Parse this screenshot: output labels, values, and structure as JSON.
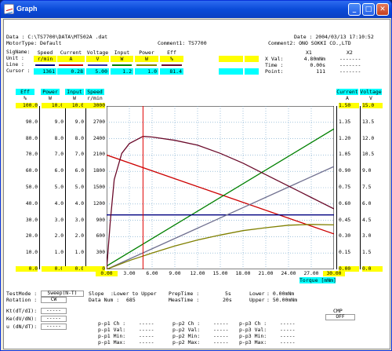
{
  "window": {
    "title": "Graph"
  },
  "header": {
    "data_label": "Data : C:\\TS7700\\DATA\\MT502A .dat",
    "date_label": "Date :  2004/03/13  17:10:52",
    "motortype_label": "MotorType: Default",
    "comment1_label": "Comment1: TS7700",
    "comment2_label": "Comment2: ONO SOKKI CO.,LTD"
  },
  "legend_table": {
    "row_labels": [
      "SigName:",
      "Unit   :",
      "Line   :",
      "Cursor :"
    ],
    "columns": [
      {
        "name": "Speed",
        "unit": "r/min",
        "cursor": "1361",
        "line_color": "#000080"
      },
      {
        "name": "Current",
        "unit": "A",
        "cursor": "0.28",
        "line_color": "#cc0000"
      },
      {
        "name": "Voltage",
        "unit": "V",
        "cursor": "5.00",
        "line_color": "#3030a0"
      },
      {
        "name": "Input",
        "unit": "W",
        "cursor": "1.2",
        "line_color": "#008000"
      },
      {
        "name": "Power",
        "unit": "W",
        "cursor": "1.0",
        "line_color": "#808000"
      },
      {
        "name": "Eff",
        "unit": "%",
        "cursor": "81.4",
        "line_color": "#6a0a2a"
      }
    ]
  },
  "cursor_panel": {
    "x1_header": "X1",
    "x2_header": "X2",
    "xval_label": "X Val:",
    "xval_value": "4.80mNm",
    "xval_x2": "-------",
    "time_label": "Time :",
    "time_value": "0.00s",
    "time_x2": "-------",
    "point_label": "Point:",
    "point_value": "111",
    "point_x2": "-------"
  },
  "chart_data": {
    "type": "line",
    "xlabel": "Torque [mNm]",
    "x_ticks": [
      "0.00",
      "3.00",
      "6.00",
      "9.00",
      "12.00",
      "15.00",
      "18.00",
      "21.00",
      "24.00",
      "27.00",
      "30.00"
    ],
    "xlim": [
      0,
      30
    ],
    "cursor_x": 4.8,
    "left_axes": [
      {
        "name": "Eff",
        "unit": "%",
        "ticks": [
          "100.0",
          "90.0",
          "80.0",
          "70.0",
          "60.0",
          "50.0",
          "40.0",
          "30.0",
          "20.0",
          "10.0",
          "0.0"
        ]
      },
      {
        "name": "Power",
        "unit": "W",
        "ticks": [
          "10.0",
          "9.0",
          "8.0",
          "7.0",
          "6.0",
          "5.0",
          "4.0",
          "3.0",
          "2.0",
          "1.0",
          "0.0"
        ]
      },
      {
        "name": "Input",
        "unit": "W",
        "ticks": [
          "10.0",
          "9.0",
          "8.0",
          "7.0",
          "6.0",
          "5.0",
          "4.0",
          "3.0",
          "2.0",
          "1.0",
          "0.0"
        ]
      },
      {
        "name": "Speed",
        "unit": "r/min",
        "ticks": [
          "3000",
          "2700",
          "2400",
          "2100",
          "1800",
          "1500",
          "1200",
          "900",
          "600",
          "300",
          "0"
        ]
      }
    ],
    "right_axes": [
      {
        "name": "Current",
        "unit": "A",
        "ticks": [
          "1.50",
          "1.35",
          "1.20",
          "1.05",
          "0.90",
          "0.75",
          "0.60",
          "0.45",
          "0.30",
          "0.15",
          "0.00"
        ]
      },
      {
        "name": "Voltage",
        "unit": "V",
        "ticks": [
          "15.0",
          "13.5",
          "12.0",
          "10.5",
          "9.0",
          "7.5",
          "6.0",
          "4.5",
          "3.0",
          "1.5",
          "0.0"
        ]
      }
    ],
    "series": [
      {
        "name": "Speed",
        "color": "#cc0000",
        "x": [
          0,
          30
        ],
        "y": [
          2100,
          650
        ]
      },
      {
        "name": "Current",
        "color": "#008000",
        "x": [
          0,
          30
        ],
        "y": [
          0.03,
          1.29
        ]
      },
      {
        "name": "Voltage",
        "color": "#000080",
        "x": [
          0,
          30
        ],
        "y": [
          5.0,
          5.0
        ]
      },
      {
        "name": "Input",
        "color": "#707090",
        "x": [
          0,
          30
        ],
        "y": [
          0.0,
          6.3
        ]
      },
      {
        "name": "Power",
        "color": "#808000",
        "x": [
          0,
          3,
          6,
          9,
          12,
          15,
          18,
          21,
          24,
          27,
          30
        ],
        "y": [
          0.0,
          0.54,
          1.0,
          1.43,
          1.8,
          2.1,
          2.37,
          2.55,
          2.7,
          2.75,
          2.72
        ]
      },
      {
        "name": "Eff",
        "color": "#6a0a2a",
        "x": [
          0,
          0.5,
          1,
          2,
          3,
          4.8,
          6,
          9,
          12,
          15,
          18,
          21,
          24,
          27,
          30
        ],
        "y": [
          0,
          30,
          55,
          71,
          77,
          81.4,
          81,
          79,
          76,
          71,
          65,
          58,
          51,
          44,
          37
        ]
      }
    ]
  },
  "bottom": {
    "testmode_label": "TestMode :",
    "testmode_value": "Sweep(N-T)",
    "rotation_label": "Rotation :",
    "rotation_value": "CW",
    "slope_label": "Slope",
    "slope_value": ":Lower to Upper",
    "datanum_label": "Data Num :",
    "datanum_value": "685",
    "preptime_label": "PrepTime :",
    "preptime_value": "5s",
    "meastime_label": "MeasTime :",
    "meastime_value": "20s",
    "lower_label": "Lower",
    "lower_value": ":   0.00mNm",
    "upper_label": "Upper",
    "upper_value": ":  50.00mNm",
    "kt_label": "Kt(dT/dI):",
    "kt_value": "-----",
    "ke_label": "Ke(dV/dN):",
    "ke_value": "-----",
    "u_label": "u (dN/dT):",
    "u_value": "-----",
    "p1": [
      "p-p1 Ch :",
      "p-p1 Val:",
      "p-p1 Min:",
      "p-p1 Max:"
    ],
    "p1_values": [
      "-----",
      "-----",
      "-----",
      "-----"
    ],
    "p2": [
      "p-p2 Ch :",
      "p-p2 Val:",
      "p-p2 Min:",
      "p-p2 Max:"
    ],
    "p2_values": [
      "-----",
      "-----",
      "-----",
      "-----"
    ],
    "p3": [
      "p-p3 Ch :",
      "p-p3 Val:",
      "p-p3 Min:",
      "p-p3 Max:"
    ],
    "p3_values": [
      "-----",
      "-----",
      "-----",
      "-----"
    ],
    "cmp_label": "CMP",
    "cmp_value": "OFF"
  }
}
